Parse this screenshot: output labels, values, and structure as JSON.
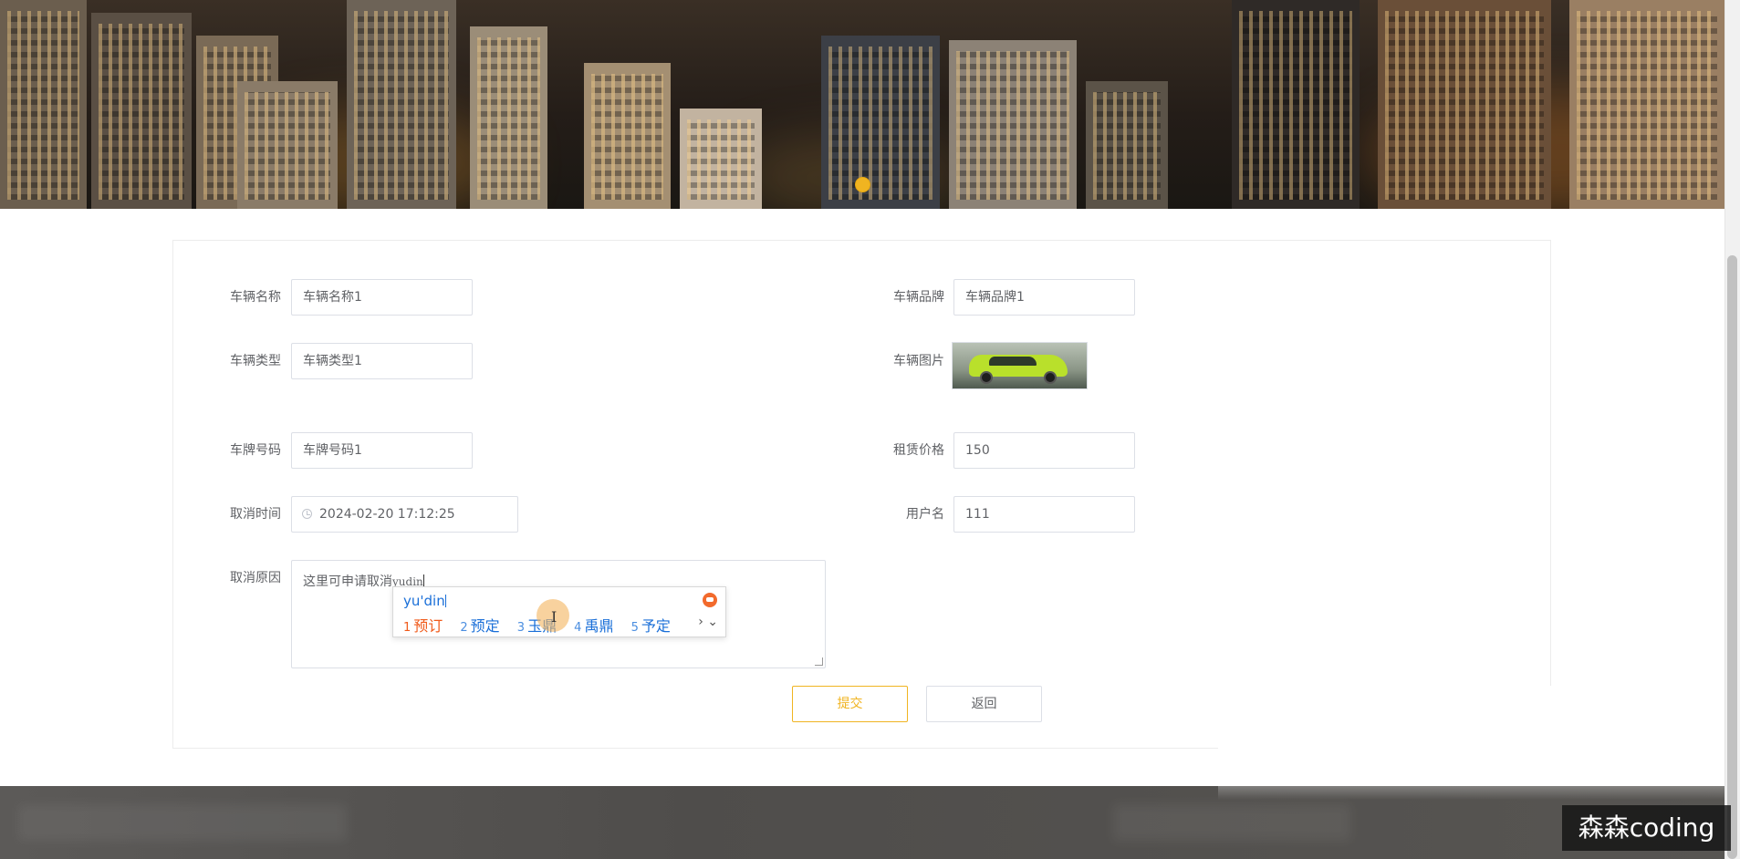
{
  "form": {
    "vehicle_name": {
      "label": "车辆名称",
      "value": "车辆名称1"
    },
    "vehicle_brand": {
      "label": "车辆品牌",
      "value": "车辆品牌1"
    },
    "vehicle_type": {
      "label": "车辆类型",
      "value": "车辆类型1"
    },
    "vehicle_image": {
      "label": "车辆图片"
    },
    "plate_number": {
      "label": "车牌号码",
      "value": "车牌号码1"
    },
    "rental_price": {
      "label": "租赁价格",
      "value": "150"
    },
    "cancel_time": {
      "label": "取消时间",
      "value": "2024-02-20 17:12:25",
      "icon": "clock-icon"
    },
    "username": {
      "label": "用户名",
      "value": "111"
    },
    "cancel_reason": {
      "label": "取消原因",
      "text": "这里可申请取消",
      "composing": "yudin"
    }
  },
  "ime": {
    "composition": "yu'din",
    "candidates": [
      {
        "num": "1",
        "text": "预订"
      },
      {
        "num": "2",
        "text": "预定"
      },
      {
        "num": "3",
        "text": "玉鼎"
      },
      {
        "num": "4",
        "text": "禹鼎"
      },
      {
        "num": "5",
        "text": "予定"
      }
    ],
    "more": "› ⌄"
  },
  "buttons": {
    "submit": "提交",
    "back": "返回"
  },
  "watermark": "森森coding",
  "colors": {
    "accent": "#f0b421",
    "ime_blue": "#1a6fd8",
    "ime_first": "#f05a1a"
  }
}
